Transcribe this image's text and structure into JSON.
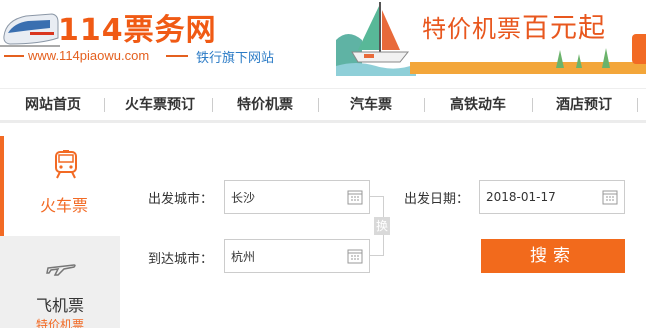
{
  "logo": {
    "title": "114票务网",
    "url": "www.114piaowu.com",
    "subtitle": "铁行旗下网站"
  },
  "banner": {
    "text_part1": "特价机票",
    "text_part2": "百元起"
  },
  "nav": {
    "items": [
      {
        "label": "网站首页"
      },
      {
        "label": "火车票预订"
      },
      {
        "label": "特价机票"
      },
      {
        "label": "汽车票"
      },
      {
        "label": "高铁动车"
      },
      {
        "label": "酒店预订"
      }
    ]
  },
  "side_tabs": {
    "train_label": "火车票",
    "plane_label": "飞机票",
    "plane_sublabel": "特价机票"
  },
  "form": {
    "from_label": "出发城市：",
    "from_value": "长沙",
    "to_label": "到达城市：",
    "to_value": "杭州",
    "date_label": "出发日期：",
    "date_value": "2018-01-17",
    "swap_label": "换",
    "search_label": "搜索"
  },
  "icons": {
    "train": "train-icon",
    "plane": "plane-icon",
    "calendar": "calendar-icon"
  },
  "colors": {
    "accent": "#f26a24",
    "link_blue": "#2b7bc6"
  }
}
